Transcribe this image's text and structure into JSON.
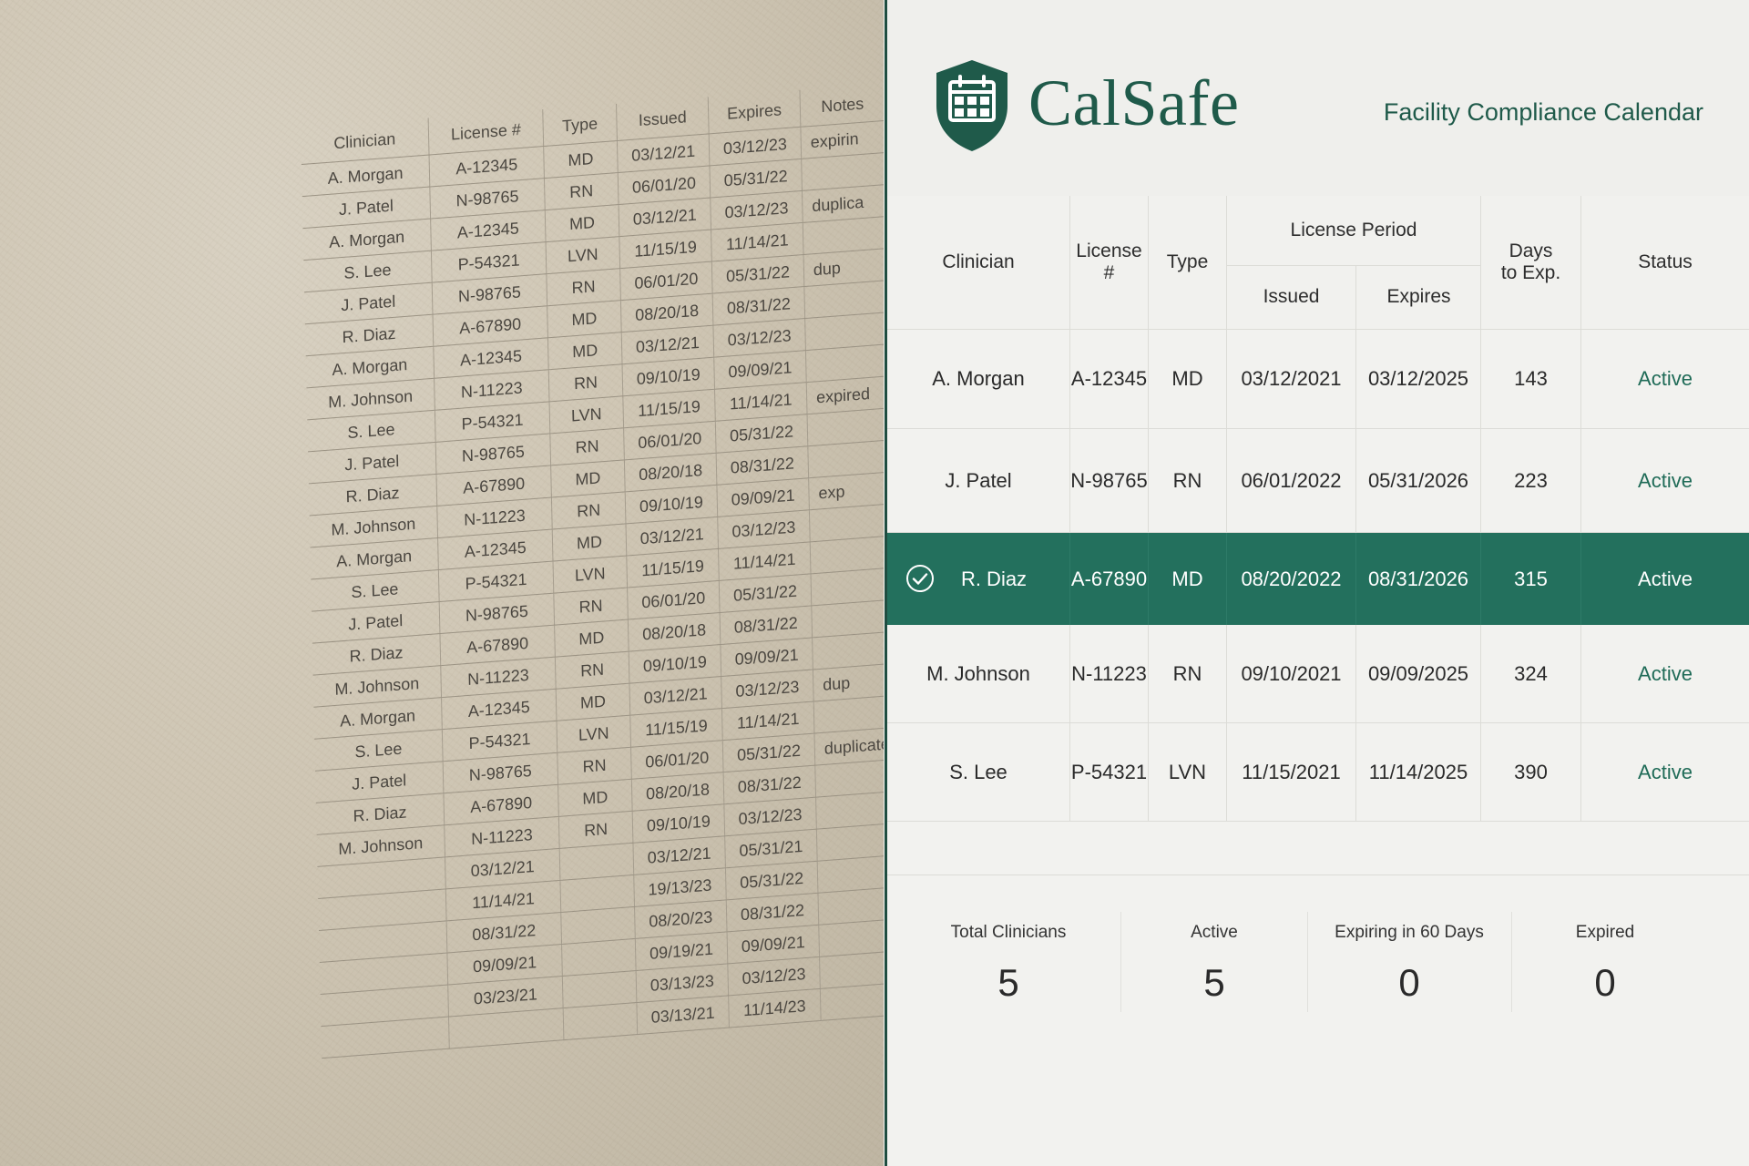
{
  "legacy_sheet": {
    "headers": [
      "Clinician",
      "License #",
      "Type",
      "Issued",
      "Expires",
      "Notes"
    ],
    "rows": [
      [
        "A. Morgan",
        "A-12345",
        "MD",
        "03/12/21",
        "03/12/23",
        "expirin"
      ],
      [
        "J. Patel",
        "N-98765",
        "RN",
        "06/01/20",
        "05/31/22",
        ""
      ],
      [
        "A. Morgan",
        "A-12345",
        "MD",
        "03/12/21",
        "03/12/23",
        "duplica"
      ],
      [
        "S. Lee",
        "P-54321",
        "LVN",
        "11/15/19",
        "11/14/21",
        ""
      ],
      [
        "J. Patel",
        "N-98765",
        "RN",
        "06/01/20",
        "05/31/22",
        "dup"
      ],
      [
        "R. Diaz",
        "A-67890",
        "MD",
        "08/20/18",
        "08/31/22",
        ""
      ],
      [
        "A. Morgan",
        "A-12345",
        "MD",
        "03/12/21",
        "03/12/23",
        ""
      ],
      [
        "M. Johnson",
        "N-11223",
        "RN",
        "09/10/19",
        "09/09/21",
        ""
      ],
      [
        "S. Lee",
        "P-54321",
        "LVN",
        "11/15/19",
        "11/14/21",
        "expired"
      ],
      [
        "J. Patel",
        "N-98765",
        "RN",
        "06/01/20",
        "05/31/22",
        ""
      ],
      [
        "R. Diaz",
        "A-67890",
        "MD",
        "08/20/18",
        "08/31/22",
        ""
      ],
      [
        "M. Johnson",
        "N-11223",
        "RN",
        "09/10/19",
        "09/09/21",
        "exp"
      ],
      [
        "A. Morgan",
        "A-12345",
        "MD",
        "03/12/21",
        "03/12/23",
        ""
      ],
      [
        "S. Lee",
        "P-54321",
        "LVN",
        "11/15/19",
        "11/14/21",
        ""
      ],
      [
        "J. Patel",
        "N-98765",
        "RN",
        "06/01/20",
        "05/31/22",
        ""
      ],
      [
        "R. Diaz",
        "A-67890",
        "MD",
        "08/20/18",
        "08/31/22",
        ""
      ],
      [
        "M. Johnson",
        "N-11223",
        "RN",
        "09/10/19",
        "09/09/21",
        ""
      ],
      [
        "A. Morgan",
        "A-12345",
        "MD",
        "03/12/21",
        "03/12/23",
        "dup"
      ],
      [
        "S. Lee",
        "P-54321",
        "LVN",
        "11/15/19",
        "11/14/21",
        ""
      ],
      [
        "J. Patel",
        "N-98765",
        "RN",
        "06/01/20",
        "05/31/22",
        "duplicate"
      ],
      [
        "R. Diaz",
        "A-67890",
        "MD",
        "08/20/18",
        "08/31/22",
        ""
      ],
      [
        "M. Johnson",
        "N-11223",
        "RN",
        "09/10/19",
        "03/12/23",
        ""
      ],
      [
        "",
        "03/12/21",
        "",
        "03/12/21",
        "05/31/21",
        ""
      ],
      [
        "",
        "11/14/21",
        "",
        "19/13/23",
        "05/31/22",
        ""
      ],
      [
        "",
        "08/31/22",
        "",
        "08/20/23",
        "08/31/22",
        ""
      ],
      [
        "",
        "09/09/21",
        "",
        "09/19/21",
        "09/09/21",
        ""
      ],
      [
        "",
        "03/23/21",
        "",
        "03/13/23",
        "03/12/23",
        ""
      ],
      [
        "",
        "",
        "",
        "03/13/21",
        "11/14/23",
        ""
      ]
    ]
  },
  "app": {
    "brand": "CalSafe",
    "subtitle": "Facility Compliance Calendar",
    "columns": {
      "clinician": "Clinician",
      "license": "License #",
      "type": "Type",
      "license_period": "License Period",
      "issued": "Issued",
      "expires": "Expires",
      "days_line1": "Days",
      "days_line2": "to Exp.",
      "status": "Status"
    },
    "rows": [
      {
        "clinician": "A. Morgan",
        "license": "A-12345",
        "type": "MD",
        "issued": "03/12/2021",
        "expires": "03/12/2025",
        "days": "143",
        "status": "Active",
        "selected": false
      },
      {
        "clinician": "J. Patel",
        "license": "N-98765",
        "type": "RN",
        "issued": "06/01/2022",
        "expires": "05/31/2026",
        "days": "223",
        "status": "Active",
        "selected": false
      },
      {
        "clinician": "R. Diaz",
        "license": "A-67890",
        "type": "MD",
        "issued": "08/20/2022",
        "expires": "08/31/2026",
        "days": "315",
        "status": "Active",
        "selected": true
      },
      {
        "clinician": "M. Johnson",
        "license": "N-11223",
        "type": "RN",
        "issued": "09/10/2021",
        "expires": "09/09/2025",
        "days": "324",
        "status": "Active",
        "selected": false
      },
      {
        "clinician": "S. Lee",
        "license": "P-54321",
        "type": "LVN",
        "issued": "11/15/2021",
        "expires": "11/14/2025",
        "days": "390",
        "status": "Active",
        "selected": false
      }
    ],
    "stats": [
      {
        "label": "Total Clinicians",
        "value": "5"
      },
      {
        "label": "Active",
        "value": "5"
      },
      {
        "label": "Expiring in 60 Days",
        "value": "0"
      },
      {
        "label": "Expired",
        "value": "0"
      }
    ],
    "colors": {
      "brand_green": "#1f5a4a",
      "selected_row": "#23705d",
      "status_active": "#1f6b57"
    },
    "icons": {
      "logo": "shield-calendar-icon",
      "selected_marker": "check-circle-icon"
    }
  }
}
